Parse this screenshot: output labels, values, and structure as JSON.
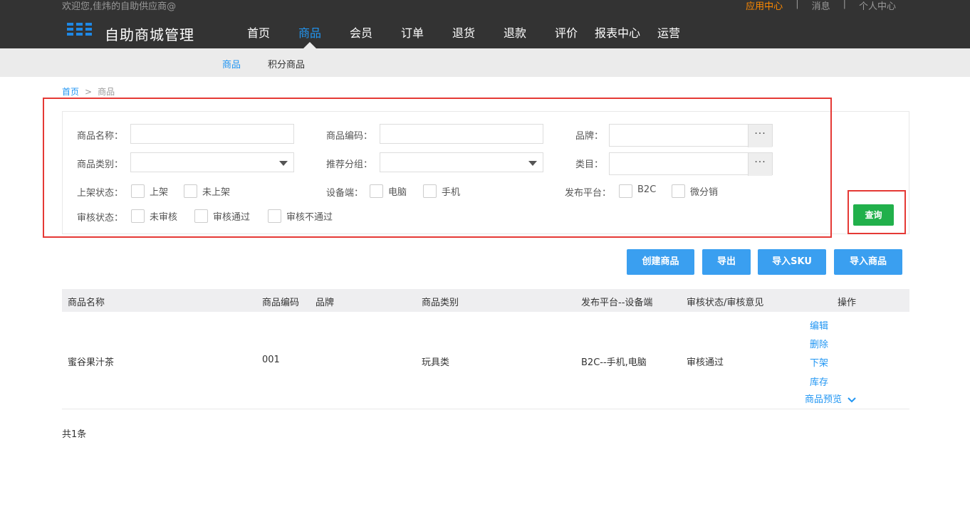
{
  "header": {
    "welcome": "欢迎您,佳炜的自助供应商@",
    "links": [
      "应用中心",
      "消息",
      "个人中心"
    ],
    "separator": "|",
    "brand": "自助商城管理",
    "nav": [
      "首页",
      "商品",
      "会员",
      "订单",
      "退货",
      "退款",
      "评价",
      "报表中心",
      "运营"
    ],
    "active_nav": "商品"
  },
  "subnav": {
    "items": [
      "商品",
      "积分商品"
    ],
    "active": "商品"
  },
  "breadcrumb": {
    "home": "首页",
    "sep": ">",
    "current": "商品"
  },
  "filter": {
    "name_label": "商品名称：",
    "name_value": "",
    "code_label": "商品编码：",
    "code_value": "",
    "brand_label": "品牌：",
    "brand_value": "",
    "brand_picker": "···",
    "category_label": "商品类别：",
    "category_value": "",
    "group_label": "推荐分组：",
    "group_value": "",
    "catalog_label": "类目：",
    "catalog_value": "",
    "catalog_picker": "···",
    "shelf_label": "上架状态：",
    "shelf_options": [
      "上架",
      "未上架"
    ],
    "device_label": "设备端：",
    "device_options": [
      "电脑",
      "手机"
    ],
    "platform_label": "发布平台：",
    "platform_options": [
      "B2C",
      "微分销"
    ],
    "audit_label": "审核状态：",
    "audit_options": [
      "未审核",
      "审核通过",
      "审核不通过"
    ],
    "query_button": "查询"
  },
  "actions": [
    "创建商品",
    "导出",
    "导入SKU",
    "导入商品"
  ],
  "table": {
    "columns": [
      "商品名称",
      "商品编码",
      "品牌",
      "商品类别",
      "发布平台--设备端",
      "审核状态/审核意见",
      "操作"
    ],
    "rows": [
      {
        "name": "蜜谷果汁茶",
        "code": "001",
        "brand": "",
        "category": "玩具类",
        "platform": "B2C--手机,电脑",
        "audit": "审核通过",
        "ops": [
          "编辑",
          "删除",
          "下架",
          "库存",
          "商品预览"
        ]
      }
    ],
    "total": "共1条"
  },
  "colors": {
    "accent": "#2196f3",
    "header_bg": "#333333",
    "query_green": "#21b04b",
    "action_blue": "#3a9ff0",
    "highlight_red": "#e53935",
    "active_orange": "#ff8a00"
  }
}
